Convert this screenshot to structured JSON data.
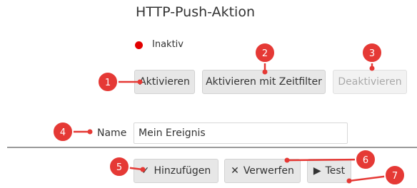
{
  "header": {
    "title": "HTTP-Push-Aktion"
  },
  "status": {
    "label": "Inaktiv",
    "color": "#e20000"
  },
  "actions": {
    "activate": "Aktivieren",
    "activate_timefilter": "Aktivieren mit Zeitfilter",
    "deactivate": "Deaktivieren"
  },
  "form": {
    "name_label": "Name",
    "name_value": "Mein Ereignis"
  },
  "footer": {
    "add": {
      "icon": "checkmark-icon",
      "glyph": "✓",
      "label": "Hinzufügen"
    },
    "discard": {
      "icon": "close-icon",
      "glyph": "✕",
      "label": "Verwerfen"
    },
    "test": {
      "icon": "play-icon",
      "glyph": "▶",
      "label": "Test"
    }
  },
  "annotations": {
    "color": "#e53935",
    "markers": [
      "1",
      "2",
      "3",
      "4",
      "5",
      "6",
      "7"
    ]
  }
}
